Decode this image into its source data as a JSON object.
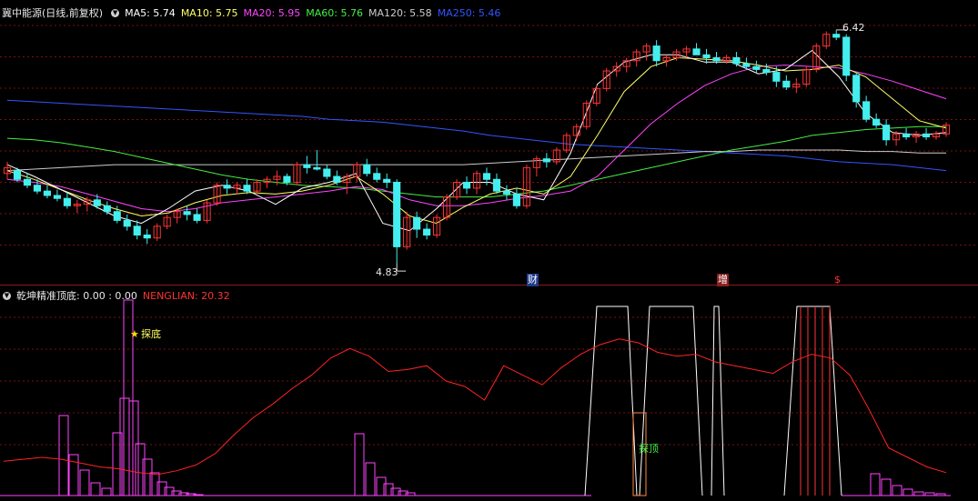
{
  "header": {
    "title": "冀中能源(日线,前复权)",
    "ma": [
      {
        "label": "MA5: 5.74",
        "color": "#ffffff"
      },
      {
        "label": "MA10: 5.75",
        "color": "#ffff66"
      },
      {
        "label": "MA20: 5.95",
        "color": "#ff44ff"
      },
      {
        "label": "MA60: 5.76",
        "color": "#44ee44"
      },
      {
        "label": "MA120: 5.58",
        "color": "#cccccc"
      },
      {
        "label": "MA250: 5.46",
        "color": "#3355ff"
      }
    ]
  },
  "price_chart": {
    "high_label": "6.42",
    "low_label": "4.83",
    "markers": {
      "cai": "财",
      "zeng": "增",
      "dollar": "$"
    }
  },
  "indicator": {
    "name": "乾坤精准顶底",
    "values": ": 0.00 : 0.00",
    "nenglian": "NENGLIAN: 20.32",
    "tandi_label": "探底",
    "tanding_label": "探顶"
  },
  "colors": {
    "up": "#ff3333",
    "down": "#44eeee",
    "grid": "#7a1010",
    "ma5": "#ffffff",
    "ma10": "#ffff66",
    "ma20": "#ff44ff",
    "ma60": "#44ee44",
    "ma120": "#cccccc",
    "ma250": "#3355ff",
    "nenglian": "#ff2222",
    "bars": "#ff44ff",
    "top": "#ffffff"
  },
  "chart_data": [
    {
      "type": "candlestick",
      "title": "冀中能源(日线,前复权)",
      "annotations": {
        "max": 6.42,
        "min": 4.83
      },
      "ohlc": [
        [
          5.44,
          5.52,
          5.4,
          5.48
        ],
        [
          5.46,
          5.48,
          5.38,
          5.4
        ],
        [
          5.4,
          5.44,
          5.34,
          5.36
        ],
        [
          5.36,
          5.4,
          5.3,
          5.32
        ],
        [
          5.32,
          5.36,
          5.27,
          5.29
        ],
        [
          5.29,
          5.33,
          5.25,
          5.27
        ],
        [
          5.27,
          5.31,
          5.2,
          5.22
        ],
        [
          5.22,
          5.26,
          5.17,
          5.23
        ],
        [
          5.23,
          5.28,
          5.18,
          5.26
        ],
        [
          5.26,
          5.3,
          5.2,
          5.22
        ],
        [
          5.22,
          5.25,
          5.16,
          5.18
        ],
        [
          5.18,
          5.22,
          5.1,
          5.12
        ],
        [
          5.12,
          5.16,
          5.05,
          5.08
        ],
        [
          5.08,
          5.12,
          4.99,
          5.02
        ],
        [
          5.02,
          5.06,
          4.96,
          5.0
        ],
        [
          5.0,
          5.1,
          4.98,
          5.08
        ],
        [
          5.08,
          5.16,
          5.06,
          5.14
        ],
        [
          5.14,
          5.2,
          5.1,
          5.18
        ],
        [
          5.18,
          5.22,
          5.12,
          5.16
        ],
        [
          5.16,
          5.2,
          5.1,
          5.12
        ],
        [
          5.12,
          5.26,
          5.1,
          5.24
        ],
        [
          5.24,
          5.38,
          5.22,
          5.36
        ],
        [
          5.36,
          5.4,
          5.3,
          5.34
        ],
        [
          5.34,
          5.38,
          5.3,
          5.36
        ],
        [
          5.36,
          5.4,
          5.3,
          5.32
        ],
        [
          5.32,
          5.4,
          5.3,
          5.38
        ],
        [
          5.38,
          5.42,
          5.34,
          5.4
        ],
        [
          5.4,
          5.46,
          5.36,
          5.42
        ],
        [
          5.42,
          5.44,
          5.36,
          5.38
        ],
        [
          5.38,
          5.52,
          5.36,
          5.5
        ],
        [
          5.5,
          5.56,
          5.44,
          5.48
        ],
        [
          5.48,
          5.6,
          5.46,
          5.47
        ],
        [
          5.47,
          5.5,
          5.4,
          5.42
        ],
        [
          5.42,
          5.46,
          5.36,
          5.38
        ],
        [
          5.38,
          5.44,
          5.3,
          5.42
        ],
        [
          5.42,
          5.52,
          5.38,
          5.5
        ],
        [
          5.5,
          5.54,
          5.42,
          5.44
        ],
        [
          5.44,
          5.48,
          5.38,
          5.4
        ],
        [
          5.4,
          5.44,
          5.34,
          5.38
        ],
        [
          5.38,
          5.4,
          4.83,
          4.94
        ],
        [
          4.94,
          5.18,
          4.92,
          5.14
        ],
        [
          5.14,
          5.18,
          5.0,
          5.06
        ],
        [
          5.06,
          5.1,
          4.99,
          5.02
        ],
        [
          5.02,
          5.16,
          5.0,
          5.14
        ],
        [
          5.14,
          5.3,
          5.12,
          5.28
        ],
        [
          5.28,
          5.4,
          5.26,
          5.38
        ],
        [
          5.38,
          5.42,
          5.3,
          5.34
        ],
        [
          5.34,
          5.46,
          5.3,
          5.44
        ],
        [
          5.44,
          5.48,
          5.36,
          5.4
        ],
        [
          5.4,
          5.44,
          5.3,
          5.32
        ],
        [
          5.32,
          5.36,
          5.26,
          5.3
        ],
        [
          5.3,
          5.34,
          5.2,
          5.22
        ],
        [
          5.22,
          5.5,
          5.2,
          5.48
        ],
        [
          5.48,
          5.56,
          5.42,
          5.54
        ],
        [
          5.54,
          5.58,
          5.48,
          5.52
        ],
        [
          5.52,
          5.62,
          5.5,
          5.6
        ],
        [
          5.6,
          5.72,
          5.58,
          5.7
        ],
        [
          5.7,
          5.78,
          5.66,
          5.76
        ],
        [
          5.76,
          5.94,
          5.74,
          5.92
        ],
        [
          5.92,
          6.04,
          5.9,
          6.02
        ],
        [
          6.02,
          6.16,
          6.0,
          6.14
        ],
        [
          6.14,
          6.2,
          6.1,
          6.17
        ],
        [
          6.17,
          6.23,
          6.13,
          6.21
        ],
        [
          6.21,
          6.29,
          6.17,
          6.27
        ],
        [
          6.27,
          6.33,
          6.21,
          6.31
        ],
        [
          6.31,
          6.35,
          6.17,
          6.21
        ],
        [
          6.21,
          6.25,
          6.17,
          6.23
        ],
        [
          6.23,
          6.29,
          6.21,
          6.27
        ],
        [
          6.27,
          6.31,
          6.23,
          6.29
        ],
        [
          6.29,
          6.33,
          6.25,
          6.25
        ],
        [
          6.25,
          6.29,
          6.19,
          6.23
        ],
        [
          6.23,
          6.27,
          6.19,
          6.21
        ],
        [
          6.21,
          6.25,
          6.19,
          6.23
        ],
        [
          6.23,
          6.27,
          6.17,
          6.19
        ],
        [
          6.19,
          6.23,
          6.15,
          6.17
        ],
        [
          6.17,
          6.21,
          6.13,
          6.15
        ],
        [
          6.15,
          6.19,
          6.11,
          6.13
        ],
        [
          6.13,
          6.17,
          6.03,
          6.07
        ],
        [
          6.07,
          6.11,
          6.01,
          6.03
        ],
        [
          6.03,
          6.09,
          5.99,
          6.05
        ],
        [
          6.05,
          6.17,
          6.03,
          6.15
        ],
        [
          6.15,
          6.33,
          6.13,
          6.31
        ],
        [
          6.31,
          6.41,
          6.29,
          6.39
        ],
        [
          6.39,
          6.42,
          6.35,
          6.37
        ],
        [
          6.37,
          6.39,
          6.07,
          6.11
        ],
        [
          6.11,
          6.13,
          5.89,
          5.93
        ],
        [
          5.93,
          5.97,
          5.79,
          5.81
        ],
        [
          5.81,
          5.85,
          5.75,
          5.77
        ],
        [
          5.77,
          5.81,
          5.63,
          5.67
        ],
        [
          5.67,
          5.73,
          5.63,
          5.71
        ],
        [
          5.71,
          5.75,
          5.67,
          5.69
        ],
        [
          5.69,
          5.73,
          5.65,
          5.71
        ],
        [
          5.71,
          5.75,
          5.67,
          5.69
        ],
        [
          5.69,
          5.73,
          5.67,
          5.71
        ],
        [
          5.71,
          5.79,
          5.69,
          5.77
        ]
      ],
      "ma": {
        "MA5": [
          5.5,
          5.42,
          5.33,
          5.24,
          5.15,
          5.1,
          5.2,
          5.32,
          5.36,
          5.32,
          5.23,
          5.34,
          5.38,
          5.44,
          5.1,
          5.05,
          5.2,
          5.38,
          5.38,
          5.3,
          5.26,
          5.58,
          6.05,
          6.2,
          6.25,
          6.25,
          6.2,
          6.2,
          6.12,
          6.15,
          6.28,
          6.1,
          5.85,
          5.72,
          5.7,
          5.72
        ],
        "MA10": [
          5.46,
          5.4,
          5.33,
          5.26,
          5.2,
          5.15,
          5.17,
          5.24,
          5.29,
          5.31,
          5.3,
          5.32,
          5.36,
          5.42,
          5.3,
          5.15,
          5.1,
          5.21,
          5.3,
          5.34,
          5.3,
          5.42,
          5.7,
          6.0,
          6.17,
          6.23,
          6.22,
          6.21,
          6.18,
          6.14,
          6.15,
          6.18,
          6.1,
          5.95,
          5.8,
          5.75
        ],
        "MA20": [
          5.4,
          5.38,
          5.35,
          5.3,
          5.25,
          5.2,
          5.18,
          5.2,
          5.24,
          5.26,
          5.28,
          5.3,
          5.32,
          5.35,
          5.33,
          5.26,
          5.22,
          5.22,
          5.24,
          5.27,
          5.29,
          5.32,
          5.42,
          5.6,
          5.78,
          5.92,
          6.04,
          6.12,
          6.17,
          6.18,
          6.17,
          6.16,
          6.12,
          6.07,
          6.01,
          5.95
        ],
        "MA60": [
          5.68,
          5.67,
          5.65,
          5.62,
          5.59,
          5.55,
          5.51,
          5.47,
          5.43,
          5.4,
          5.38,
          5.36,
          5.35,
          5.34,
          5.32,
          5.3,
          5.28,
          5.28,
          5.28,
          5.3,
          5.32,
          5.36,
          5.4,
          5.44,
          5.48,
          5.52,
          5.56,
          5.6,
          5.63,
          5.66,
          5.7,
          5.72,
          5.74,
          5.75,
          5.76,
          5.76
        ],
        "MA120": [
          5.46,
          5.47,
          5.48,
          5.49,
          5.5,
          5.5,
          5.5,
          5.5,
          5.5,
          5.5,
          5.5,
          5.5,
          5.5,
          5.5,
          5.5,
          5.5,
          5.5,
          5.5,
          5.51,
          5.52,
          5.53,
          5.54,
          5.55,
          5.56,
          5.57,
          5.58,
          5.59,
          5.59,
          5.6,
          5.6,
          5.6,
          5.6,
          5.59,
          5.59,
          5.58,
          5.58
        ],
        "MA250": [
          5.94,
          5.93,
          5.92,
          5.91,
          5.9,
          5.89,
          5.88,
          5.87,
          5.86,
          5.85,
          5.84,
          5.83,
          5.81,
          5.8,
          5.79,
          5.77,
          5.75,
          5.73,
          5.7,
          5.68,
          5.66,
          5.64,
          5.63,
          5.62,
          5.61,
          5.6,
          5.59,
          5.58,
          5.57,
          5.56,
          5.54,
          5.52,
          5.51,
          5.5,
          5.48,
          5.46
        ]
      },
      "markers": [
        "财",
        "增",
        "$"
      ]
    },
    {
      "type": "line",
      "title": "乾坤精准顶底",
      "series": [
        {
          "name": "NENGLIAN",
          "values": [
            18,
            19,
            20,
            19,
            17,
            15,
            14,
            12,
            11,
            13,
            16,
            22,
            32,
            41,
            48,
            56,
            63,
            72,
            77,
            73,
            65,
            66,
            68,
            60,
            57,
            50,
            68,
            63,
            58,
            67,
            74,
            79,
            82,
            80,
            75,
            73,
            74,
            70,
            68,
            66,
            64,
            70,
            74,
            72,
            63,
            45,
            25,
            20,
            15,
            12
          ]
        }
      ]
    }
  ]
}
